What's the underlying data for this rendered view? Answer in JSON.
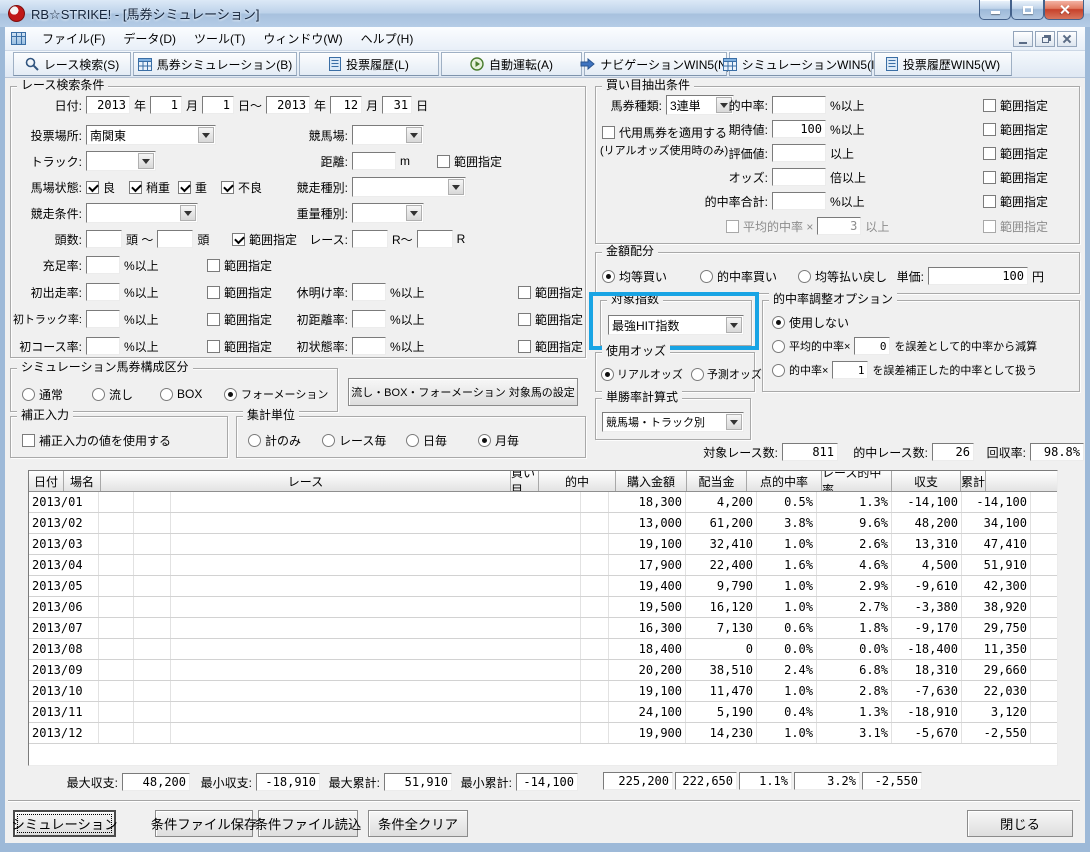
{
  "window": {
    "title": "RB☆STRIKE! - [馬券シミュレーション]"
  },
  "menu": {
    "items": [
      "ファイル(F)",
      "データ(D)",
      "ツール(T)",
      "ウィンドウ(W)",
      "ヘルプ(H)"
    ]
  },
  "toolbar": {
    "buttons": [
      {
        "label": "レース検索(S)",
        "icon": "search"
      },
      {
        "label": "馬券シミュレーション(B)",
        "icon": "grid"
      },
      {
        "label": "投票履歴(L)",
        "icon": "document"
      },
      {
        "label": "自動運転(A)",
        "icon": "auto"
      },
      {
        "label": "ナビゲーションWIN5(N)",
        "icon": "arrow"
      },
      {
        "label": "シミュレーションWIN5(I)",
        "icon": "grid"
      },
      {
        "label": "投票履歴WIN5(W)",
        "icon": "document"
      }
    ]
  },
  "search": {
    "title": "レース検索条件",
    "date": {
      "label": "日付:",
      "y1": "2013",
      "u1": "年",
      "m1": "1",
      "u2": "月",
      "d1": "1",
      "u3": "日～",
      "y2": "2013",
      "u4": "年",
      "m2": "12",
      "u5": "月",
      "d2": "31",
      "u6": "日"
    },
    "place": {
      "label": "投票場所:",
      "value": "南関東"
    },
    "course": {
      "label": "競馬場:",
      "value": ""
    },
    "track": {
      "label": "トラック:",
      "value": ""
    },
    "distance": {
      "label": "距離:",
      "value": "",
      "unit": "m",
      "range": "範囲指定",
      "range_checked": false
    },
    "condition": {
      "label": "馬場状態:",
      "options": [
        "良",
        "稍重",
        "重",
        "不良"
      ],
      "checked": [
        true,
        true,
        true,
        true
      ]
    },
    "race_type": {
      "label": "競走種別:",
      "value": ""
    },
    "race_cond": {
      "label": "競走条件:",
      "value": ""
    },
    "weight_type": {
      "label": "重量種別:",
      "value": ""
    },
    "heads": {
      "label": "頭数:",
      "v1": "",
      "u1": "頭 ～",
      "v2": "",
      "u2": "頭",
      "range": "範囲指定",
      "range_checked": true
    },
    "race_no": {
      "label": "レース:",
      "v1": "",
      "u1": "R～",
      "v2": "",
      "u2": "R"
    },
    "sufficiency": {
      "label": "充足率:",
      "value": "",
      "unit": "%以上",
      "range": "範囲指定"
    },
    "first_run": {
      "label": "初出走率:",
      "value": "",
      "unit": "%以上",
      "range": "範囲指定"
    },
    "rest": {
      "label": "休明け率:",
      "value": "",
      "unit": "%以上",
      "range": "範囲指定"
    },
    "first_track": {
      "label": "初トラック率:",
      "value": "",
      "unit": "%以上",
      "range": "範囲指定"
    },
    "first_dist": {
      "label": "初距離率:",
      "value": "",
      "unit": "%以上",
      "range": "範囲指定"
    },
    "first_course": {
      "label": "初コース率:",
      "value": "",
      "unit": "%以上",
      "range": "範囲指定"
    },
    "first_state": {
      "label": "初状態率:",
      "value": "",
      "unit": "%以上",
      "range": "範囲指定"
    }
  },
  "composition": {
    "title": "シミュレーション馬券構成区分",
    "options": [
      "通常",
      "流し",
      "BOX",
      "フォーメーション"
    ],
    "selected": "フォーメーション"
  },
  "target_horse_button": "流し・BOX・フォーメーション 対象馬の設定",
  "correction": {
    "title": "補正入力",
    "checkbox": "補正入力の値を使用する",
    "checked": false
  },
  "aggregation": {
    "title": "集計単位",
    "options": [
      "計のみ",
      "レース毎",
      "日毎",
      "月毎"
    ],
    "selected": "月毎"
  },
  "extraction": {
    "title": "買い目抽出条件",
    "ticket_type": {
      "label": "馬券種類:",
      "value": "3連単"
    },
    "substitute": {
      "checkbox": "代用馬券を適用する",
      "note": "(リアルオッズ使用時のみ)",
      "checked": false
    },
    "range_label": "範囲指定",
    "rows": [
      {
        "label": "的中率:",
        "value": "",
        "unit": "%以上"
      },
      {
        "label": "期待値:",
        "value": "100",
        "unit": "%以上"
      },
      {
        "label": "評価値:",
        "value": "",
        "unit": "以上"
      },
      {
        "label": "オッズ:",
        "value": "",
        "unit": "倍以上"
      },
      {
        "label": "的中率合計:",
        "value": "",
        "unit": "%以上"
      }
    ],
    "average": {
      "label": "平均的中率 ×",
      "value": "3",
      "unit": "以上",
      "enabled": false
    }
  },
  "allocation": {
    "title": "金額配分",
    "options": [
      "均等買い",
      "的中率買い",
      "均等払い戻し"
    ],
    "selected": "均等買い",
    "unit_price": {
      "label": "単価:",
      "value": "100",
      "unit": "円"
    }
  },
  "target_index": {
    "title": "対象指数",
    "value": "最強HIT指数",
    "highlight_color": "#18a4e4"
  },
  "odds": {
    "title": "使用オッズ",
    "options": [
      "リアルオッズ",
      "予測オッズ"
    ],
    "selected": "リアルオッズ"
  },
  "hit_adjust": {
    "title": "的中率調整オプション",
    "selected": "使用しない",
    "option1": "使用しない",
    "option2": {
      "pre": "平均的中率×",
      "value": "0",
      "post": "を誤差として的中率から減算"
    },
    "option3": {
      "pre": "的中率×",
      "value": "1",
      "post": "を誤差補正した的中率として扱う"
    }
  },
  "win_calc": {
    "title": "単勝率計算式",
    "value": "競馬場・トラック別"
  },
  "stats": {
    "target_label": "対象レース数:",
    "target": "811",
    "hit_label": "的中レース数:",
    "hit": "26",
    "payback_label": "回収率:",
    "payback": "98.8%"
  },
  "table": {
    "columns": [
      "日付",
      "場名",
      "レース",
      "買い目",
      "的中",
      "購入金額",
      "配当金",
      "点的中率",
      "レース的中率",
      "収支",
      "累計"
    ],
    "rows": [
      [
        "2013/01",
        "",
        "",
        "",
        "",
        "18,300",
        "4,200",
        "0.5%",
        "1.3%",
        "-14,100",
        "-14,100"
      ],
      [
        "2013/02",
        "",
        "",
        "",
        "",
        "13,000",
        "61,200",
        "3.8%",
        "9.6%",
        "48,200",
        "34,100"
      ],
      [
        "2013/03",
        "",
        "",
        "",
        "",
        "19,100",
        "32,410",
        "1.0%",
        "2.6%",
        "13,310",
        "47,410"
      ],
      [
        "2013/04",
        "",
        "",
        "",
        "",
        "17,900",
        "22,400",
        "1.6%",
        "4.6%",
        "4,500",
        "51,910"
      ],
      [
        "2013/05",
        "",
        "",
        "",
        "",
        "19,400",
        "9,790",
        "1.0%",
        "2.9%",
        "-9,610",
        "42,300"
      ],
      [
        "2013/06",
        "",
        "",
        "",
        "",
        "19,500",
        "16,120",
        "1.0%",
        "2.7%",
        "-3,380",
        "38,920"
      ],
      [
        "2013/07",
        "",
        "",
        "",
        "",
        "16,300",
        "7,130",
        "0.6%",
        "1.8%",
        "-9,170",
        "29,750"
      ],
      [
        "2013/08",
        "",
        "",
        "",
        "",
        "18,400",
        "0",
        "0.0%",
        "0.0%",
        "-18,400",
        "11,350"
      ],
      [
        "2013/09",
        "",
        "",
        "",
        "",
        "20,200",
        "38,510",
        "2.4%",
        "6.8%",
        "18,310",
        "29,660"
      ],
      [
        "2013/10",
        "",
        "",
        "",
        "",
        "19,100",
        "11,470",
        "1.0%",
        "2.8%",
        "-7,630",
        "22,030"
      ],
      [
        "2013/11",
        "",
        "",
        "",
        "",
        "24,100",
        "5,190",
        "0.4%",
        "1.3%",
        "-18,910",
        "3,120"
      ],
      [
        "2013/12",
        "",
        "",
        "",
        "",
        "19,900",
        "14,230",
        "1.0%",
        "3.1%",
        "-5,670",
        "-2,550"
      ]
    ]
  },
  "summary": {
    "max_balance": {
      "label": "最大収支:",
      "value": "48,200"
    },
    "min_balance": {
      "label": "最小収支:",
      "value": "-18,910"
    },
    "max_total": {
      "label": "最大累計:",
      "value": "51,910"
    },
    "min_total": {
      "label": "最小累計:",
      "value": "-14,100"
    },
    "totals": [
      "225,200",
      "222,650",
      "1.1%",
      "3.2%",
      "-2,550"
    ]
  },
  "footer": {
    "buttons": [
      "シミュレーション",
      "条件ファイル保存",
      "条件ファイル読込",
      "条件全クリア"
    ],
    "close": "閉じる"
  }
}
